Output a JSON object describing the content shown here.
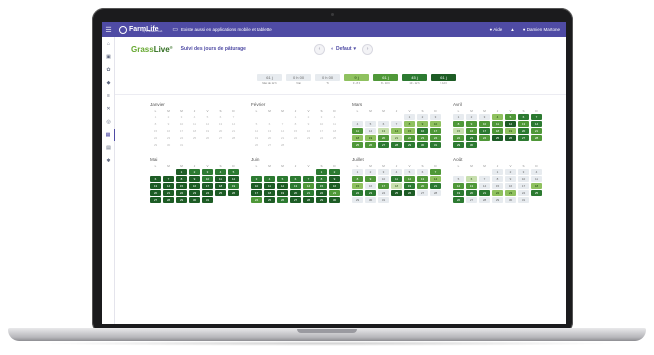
{
  "appbar": {
    "brand": "FarmLife",
    "brand_sub": "by Innovation Lab",
    "promo": "Existe aussi en applications mobile et tablette",
    "help": "Aide",
    "user": "Damien Martone"
  },
  "sidebar": {
    "icons": [
      "home-icon",
      "farm-icon",
      "grass-icon",
      "herd-icon",
      "notes-icon",
      "tools-icon",
      "map-icon",
      "calendar-icon",
      "documents-icon",
      "settings-icon"
    ]
  },
  "header": {
    "brand_a": "Grass",
    "brand_b": "Live",
    "brand_reg": "®",
    "title": "Suivi des jours de pâturage",
    "preset": "Defaut"
  },
  "legend": [
    {
      "value": "61 j",
      "caption": "Max de 12 h"
    },
    {
      "value": "0 h 00",
      "caption": "Vrai"
    },
    {
      "value": "0 h 00",
      "caption": "Tt"
    },
    {
      "value": "9 j",
      "caption": "0 - 8 h"
    },
    {
      "value": "61 j",
      "caption": "8 - 10 h"
    },
    {
      "value": "45 j",
      "caption": "10 - 12 h"
    },
    {
      "value": "61 j",
      "caption": "> 12 h"
    }
  ],
  "colors": {
    "appbar": "#4f4ba4",
    "grass_light": "#66a830",
    "grass_dark": "#2e6b1d",
    "level_0": "#ffffff",
    "level_1": "#e7ebef",
    "level_2": "#c7dfae",
    "level_3": "#8fc15f",
    "level_4": "#4f9838",
    "level_5": "#2c7a31",
    "level_6": "#1d5c25"
  },
  "weekdays": [
    "L",
    "M",
    "M",
    "J",
    "V",
    "S",
    "D"
  ],
  "months": [
    {
      "name": "Janvier",
      "offset": 0,
      "days": 31,
      "levels": "0000000000000000000000000000000"
    },
    {
      "name": "Février",
      "offset": 3,
      "days": 28,
      "levels": "0000000000000000000000000000"
    },
    {
      "name": "Mars",
      "offset": 4,
      "days": 31,
      "levels": "1111111333412335433424444455555"
    },
    {
      "name": "Avril",
      "offset": 0,
      "days": 30,
      "levels": "111345544446452454354454665455"
    },
    {
      "name": "Mai",
      "offset": 2,
      "days": 31,
      "levels": "6555566665666666665666666666666"
    },
    {
      "name": "Juin",
      "offset": 5,
      "days": 30,
      "levels": "555555556666545666665644656666"
    },
    {
      "name": "Juillet",
      "offset": 0,
      "days": 31,
      "levels": "1111114441544331425455516611111"
    },
    {
      "name": "Août",
      "offset": 3,
      "days": 31,
      "levels": "1111121111144111135553315511111"
    }
  ]
}
